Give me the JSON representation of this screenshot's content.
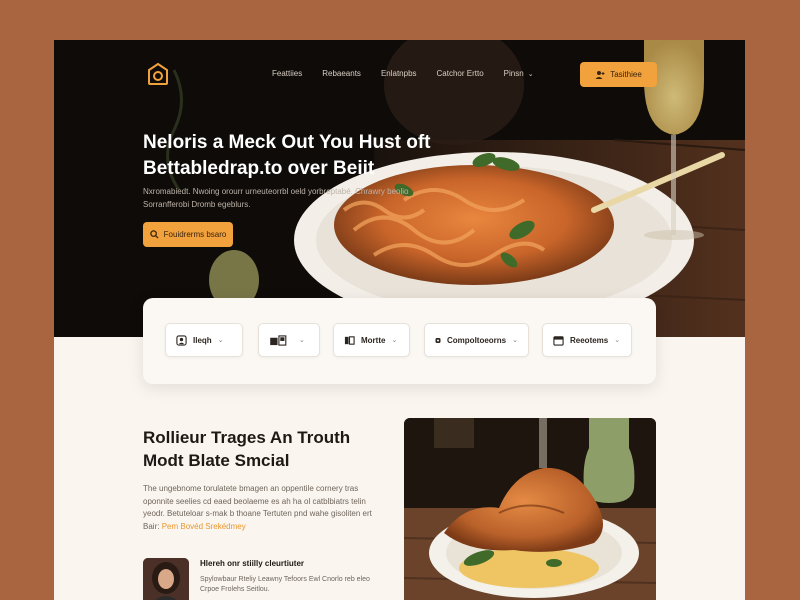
{
  "colors": {
    "accent": "#f2a23c",
    "page_bg": "#a8653f",
    "hero_bg": "#0b0a09",
    "surface": "#faf6ef",
    "text_dark": "#1d1915"
  },
  "header": {
    "logo_icon": "restaurant-logo-icon",
    "nav": [
      {
        "label": "Feattiies"
      },
      {
        "label": "Rebaeants"
      },
      {
        "label": "Enlatnpbs"
      },
      {
        "label": "Catchor Ertto"
      },
      {
        "label": "Pinsn",
        "has_dropdown": true
      }
    ],
    "cta": {
      "label": "Tasithiee",
      "icon": "user-plus-icon"
    }
  },
  "hero": {
    "title_line1": "Neloris a Meck Out You Hust oft",
    "title_line2": "Bettabledrap.to over Beiit",
    "subtitle": "Nxromabiedt. Nwoing orourr urneuteorrbl oeld yorbreptabé. Chrawry beolio Sorranfferobi Dromb egeblurs.",
    "button_label": "Fouidrerms bsaro",
    "button_icon": "search-icon"
  },
  "filters": [
    {
      "label": "Ileqh",
      "icon": "person-icon"
    },
    {
      "label": "",
      "icon": "layout-icon"
    },
    {
      "label": "Mortte",
      "icon": "map-icon"
    },
    {
      "label": "Compoltoeorns",
      "icon": "pin-icon"
    },
    {
      "label": "Reeotems",
      "icon": "calendar-icon"
    }
  ],
  "section": {
    "title_line1": "Rollieur Trages An Trouth",
    "title_line2": "Modt Blate Smcial",
    "body": "The ungebnome torulatete bmagen an oppentile cornery tras oponnite seelies cd eaed beolaeme es ah ha ol catblbiatrs telin yeodr. Betuteloar s-mak b thoane Tertuten pnd wahe gisoliten ert",
    "body_tail": "Bair:",
    "link": "Pem Bovéd Srekédmey",
    "person_name": "Hlereh onr stiilly cleurtiuter",
    "person_role": "Spylowbaur Rteliy Leawny Tefoors Ewl Cnorlo reb eleo Crpoe Frolehs Seitlou."
  }
}
